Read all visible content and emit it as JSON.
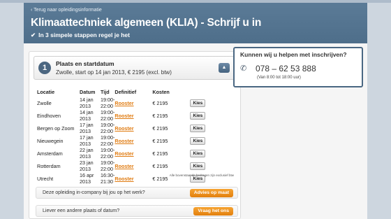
{
  "header": {
    "back_link": "‹ Terug naar opleidingsinformatie",
    "title": "Klimaattechniek algemeen (KLIA) - Schrijf u in",
    "subtitle": "In 3 simpele stappen regel je het"
  },
  "step": {
    "number": "1",
    "title": "Plaats en startdatum",
    "summary": "Zwolle, start op 14 jan 2013, € 2195 (excl. btw)",
    "collapse_icon": "chevron-up-icon"
  },
  "table": {
    "headers": [
      "Locatie",
      "Datum",
      "Tijd",
      "Definitief",
      "Kosten"
    ],
    "rows": [
      {
        "locatie": "Zwolle",
        "datum": "14 jan 2013",
        "tijd": "19:00-22:00",
        "definitief": "Rooster",
        "kosten": "€ 2195",
        "action": "Kies"
      },
      {
        "locatie": "Eindhoven",
        "datum": "14 jan 2013",
        "tijd": "19:00-22:00",
        "definitief": "Rooster",
        "kosten": "€ 2195",
        "action": "Kies"
      },
      {
        "locatie": "Bergen op Zoom",
        "datum": "17 jan 2013",
        "tijd": "19:00-22:00",
        "definitief": "Rooster",
        "kosten": "€ 2195",
        "action": "Kies"
      },
      {
        "locatie": "Nieuwegein",
        "datum": "17 jan 2013",
        "tijd": "19:00-22:00",
        "definitief": "Rooster",
        "kosten": "€ 2195",
        "action": "Kies"
      },
      {
        "locatie": "Amsterdam",
        "datum": "22 jan 2013",
        "tijd": "19:00-22:00",
        "definitief": "Rooster",
        "kosten": "€ 2195",
        "action": "Kies"
      },
      {
        "locatie": "Rotterdam",
        "datum": "23 jan 2013",
        "tijd": "19:00-22:00",
        "definitief": "Rooster",
        "kosten": "€ 2195",
        "action": "Kies"
      },
      {
        "locatie": "Utrecht",
        "datum": "16 apr 2013",
        "tijd": "16:30-21:30",
        "definitief": "Rooster",
        "kosten": "€ 2195",
        "action": "Kies"
      }
    ],
    "footnote": "Alle bovenstaande bedragen zijn exclusief btw"
  },
  "incompany": {
    "question": "Deze opleiding in-company bij jou op het werk?",
    "button": "Advies op maat"
  },
  "other_date": {
    "question": "Liever een andere plaats of datum?",
    "button": "Vraag het ons"
  },
  "help": {
    "title": "Kunnen wij u helpen met inschrijven?",
    "phone": "078 – 62 53 888",
    "hours": "(Van 8:00 tot 18:00 uur)",
    "icon": "phone-icon"
  },
  "colors": {
    "header_bg": "#54748f",
    "accent": "#e98a1c",
    "link": "#e07b10"
  }
}
